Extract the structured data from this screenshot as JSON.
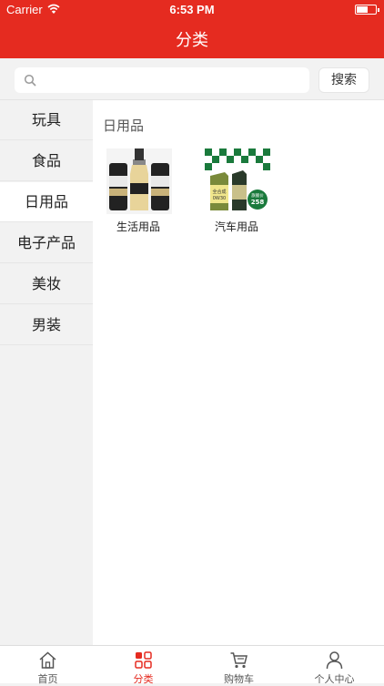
{
  "status": {
    "carrier": "Carrier",
    "time": "6:53 PM"
  },
  "nav": {
    "title": "分类"
  },
  "search": {
    "placeholder": "",
    "button_label": "搜索"
  },
  "sidebar": {
    "items": [
      {
        "label": "玩具"
      },
      {
        "label": "食品"
      },
      {
        "label": "日用品"
      },
      {
        "label": "电子产品"
      },
      {
        "label": "美妆"
      },
      {
        "label": "男装"
      }
    ],
    "active_index": 2
  },
  "content": {
    "section_title": "日用品",
    "products": [
      {
        "label": "生活用品",
        "image": "beer-cans-image"
      },
      {
        "label": "汽车用品",
        "image": "motor-oil-image",
        "image_text": [
          "全合成",
          "0W30",
          "旗舰价",
          "258"
        ]
      }
    ]
  },
  "tabbar": {
    "tabs": [
      {
        "label": "首页",
        "icon": "home-icon"
      },
      {
        "label": "分类",
        "icon": "category-icon"
      },
      {
        "label": "购物车",
        "icon": "cart-icon"
      },
      {
        "label": "个人中心",
        "icon": "user-icon"
      }
    ],
    "active_index": 1
  },
  "colors": {
    "brand": "#e52b20",
    "background": "#f2f2f2"
  }
}
